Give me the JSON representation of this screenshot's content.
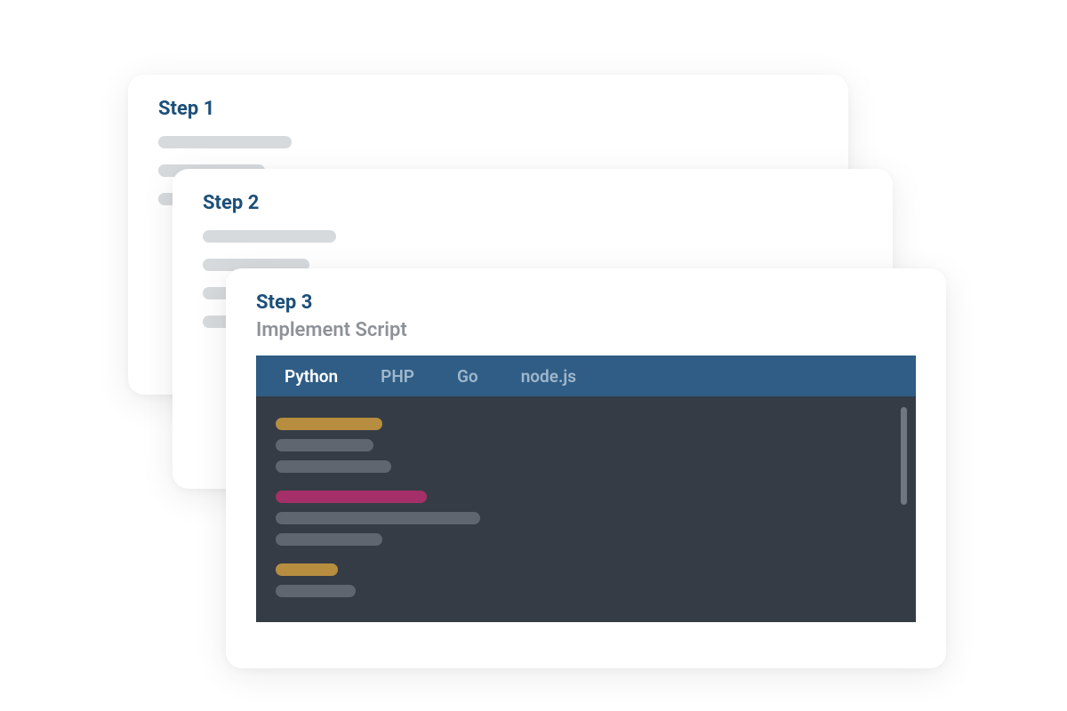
{
  "cards": {
    "step1": {
      "title": "Step 1"
    },
    "step2": {
      "title": "Step 2"
    },
    "step3": {
      "title": "Step 3",
      "subtitle": "Implement Script",
      "tabs": [
        "Python",
        "PHP",
        "Go",
        "node.js"
      ],
      "active_tab": "Python"
    }
  },
  "colors": {
    "step_title": "#1c4f78",
    "subtitle": "#8d9298",
    "tab_bar": "#2f5d86",
    "code_bg": "#353c45",
    "code_gold": "#b78d3f",
    "code_gray": "#5f6670",
    "code_magenta": "#a52f68",
    "placeholder": "#d7dadd"
  }
}
